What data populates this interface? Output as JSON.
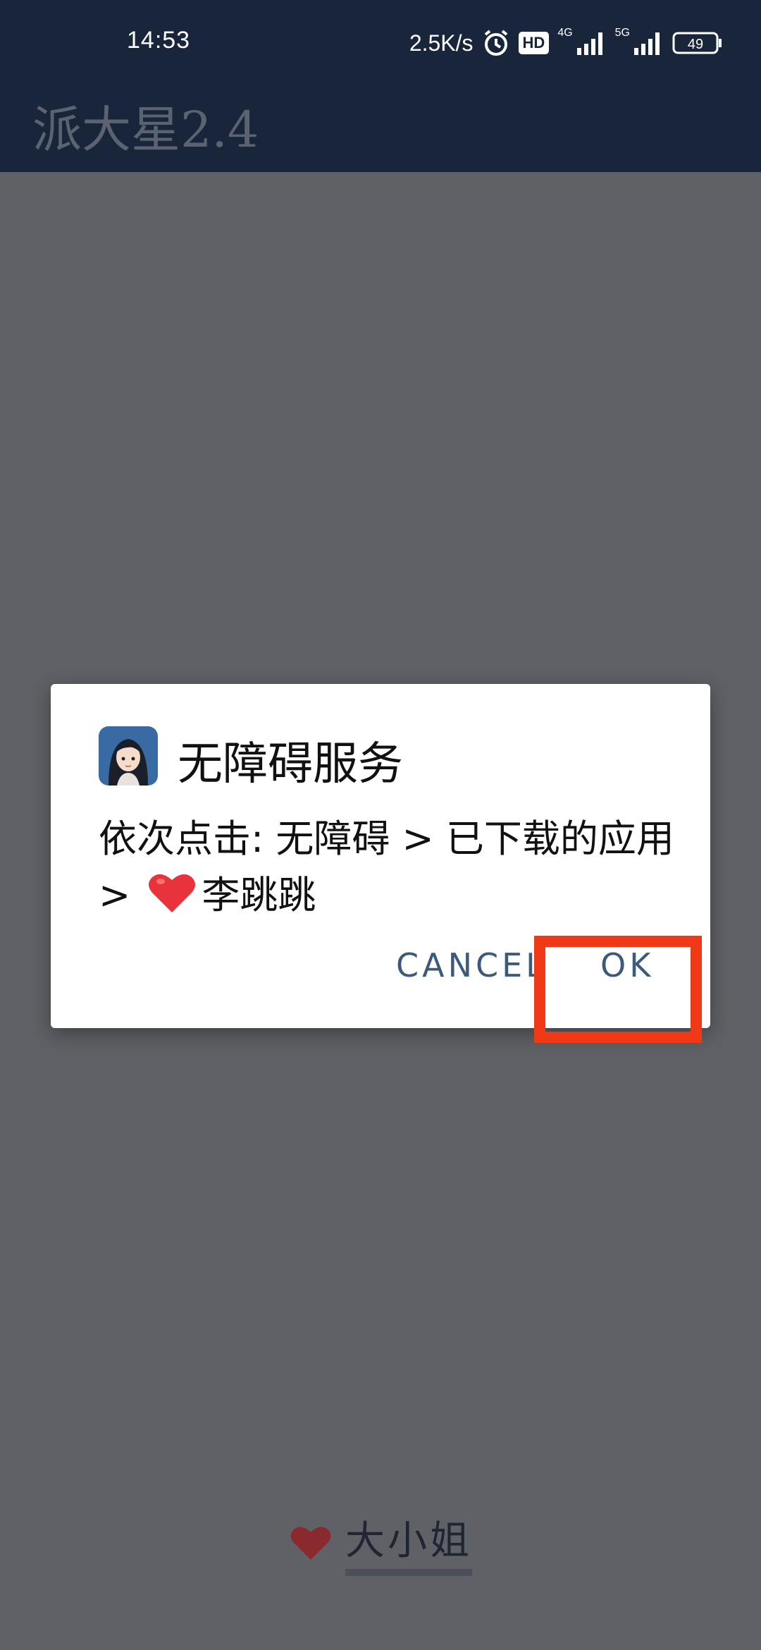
{
  "status_bar": {
    "time": "14:53",
    "speed": "2.5K/s",
    "hd_label": "HD",
    "net1": "4G",
    "net2": "5G",
    "battery": "49"
  },
  "app": {
    "title": "派大星2.4"
  },
  "dialog": {
    "title": "无障碍服务",
    "message_part1": "依次点击: 无障碍 > 已下载的应用 >",
    "message_part2": "李跳跳",
    "cancel_label": "CANCEL",
    "ok_label": "OK",
    "icon": "avatar-girl-icon"
  },
  "footer": {
    "label": "大小姐",
    "icon": "heart-icon"
  },
  "colors": {
    "appbar": "#19253a",
    "scrim": "#5f6166",
    "button_text": "#3c5a7a",
    "highlight": "#f03a17",
    "heart": "#e8323c"
  }
}
